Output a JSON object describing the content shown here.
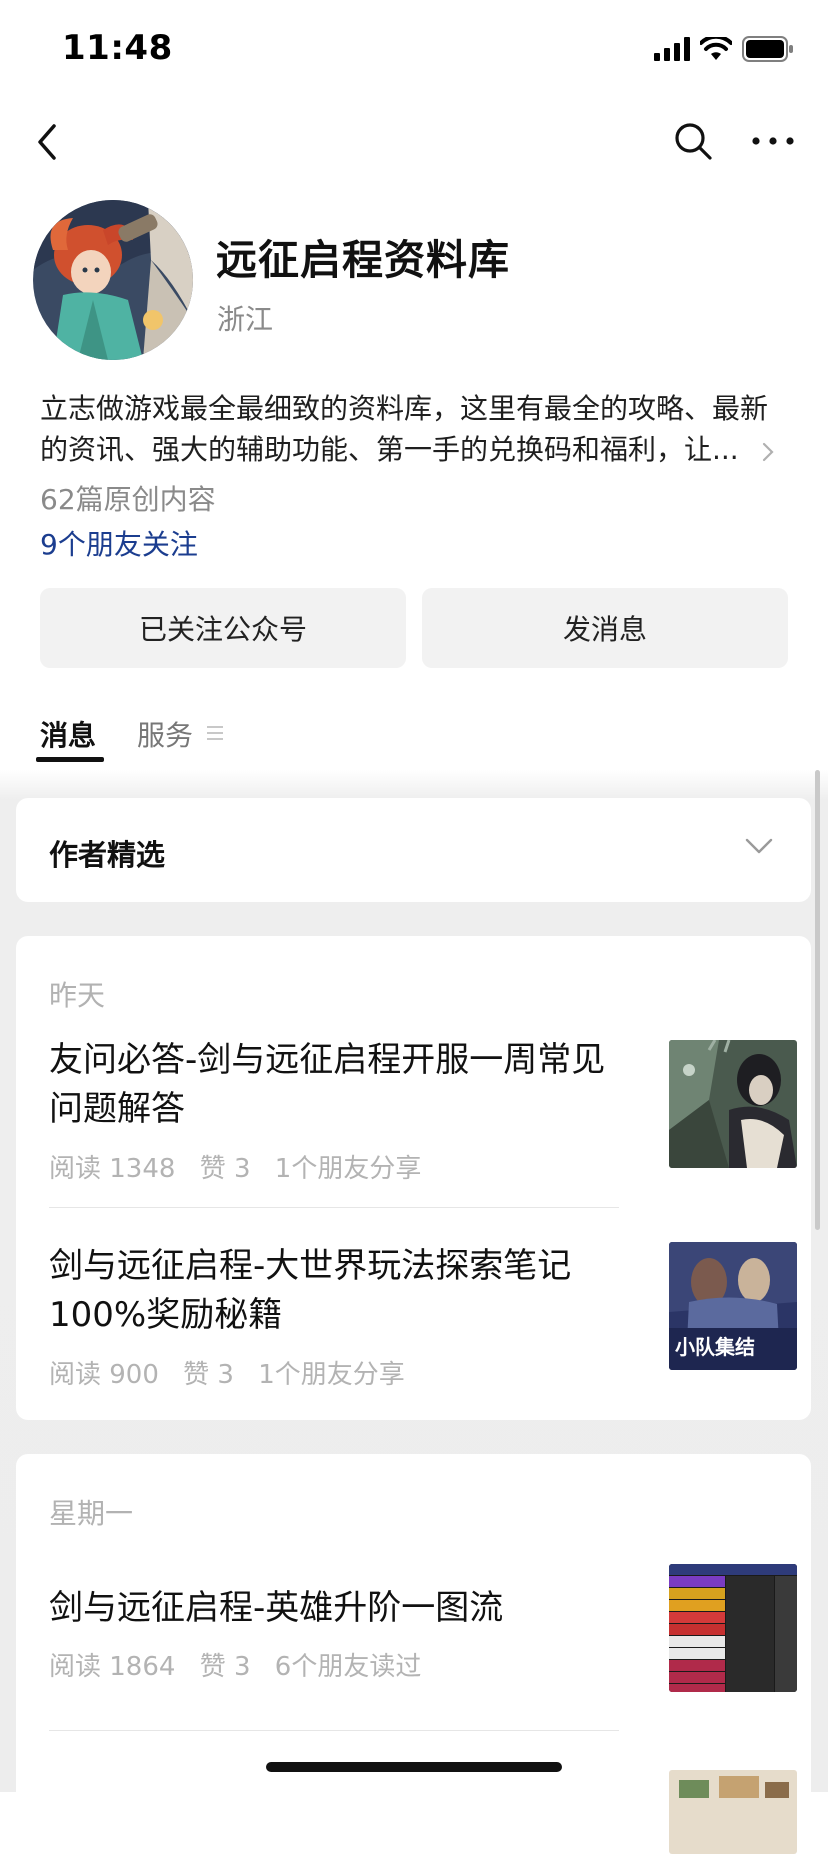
{
  "status_bar": {
    "time": "11:48"
  },
  "account": {
    "name": "远征启程资料库",
    "region": "浙江",
    "description": "立志做游戏最全最细致的资料库，这里有最全的攻略、最新的资讯、强大的辅助功能、第一手的兑换码和福利，让...",
    "original_count": "62篇原创内容",
    "friends_follow": "9个朋友关注"
  },
  "buttons": {
    "followed": "已关注公众号",
    "send_message": "发消息"
  },
  "tabs": {
    "messages": "消息",
    "services": "服务"
  },
  "author_picks": {
    "title": "作者精选"
  },
  "feed": {
    "groups": [
      {
        "day": "昨天",
        "articles": [
          {
            "title": "友问必答-剑与远征启程开服一周常见问题解答",
            "reads": "阅读 1348",
            "likes": "赞 3",
            "social": "1个朋友分享",
            "thumb_icon": "dark-fantasy-character-thumbnail"
          },
          {
            "title": "剑与远征启程-大世界玩法探索笔记100%奖励秘籍",
            "reads": "阅读 900",
            "likes": "赞 3",
            "social": "1个朋友分享",
            "thumb_icon": "squad-poster-thumbnail",
            "thumb_text": "小队集结"
          }
        ]
      },
      {
        "day": "星期一",
        "articles": [
          {
            "title": "剑与远征启程-英雄升阶一图流",
            "reads": "阅读 1864",
            "likes": "赞 3",
            "social": "6个朋友读过",
            "thumb_icon": "hero-rank-table-thumbnail"
          }
        ]
      }
    ]
  },
  "colors": {
    "link_blue": "#1b3d8f",
    "muted_gray": "#8a8a8a",
    "feed_bg": "#ededed"
  }
}
